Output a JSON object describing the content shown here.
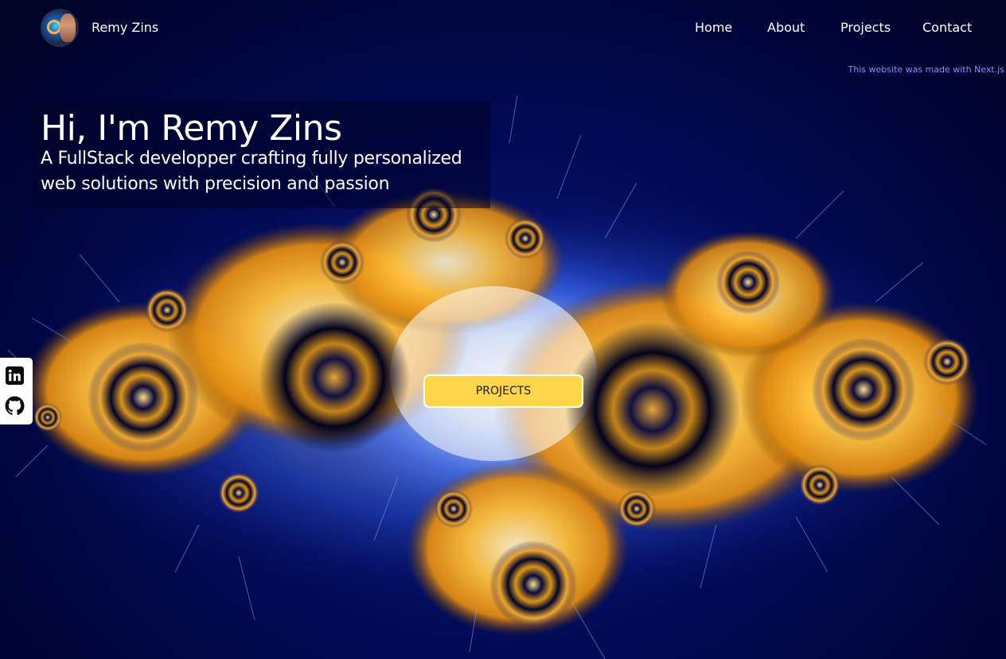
{
  "header": {
    "brand_name": "Remy Zins",
    "avatar_icon": "avatar-photo",
    "nav": [
      {
        "label": "Home"
      },
      {
        "label": "About"
      },
      {
        "label": "Projects"
      },
      {
        "label": "Contact"
      }
    ]
  },
  "notice": {
    "made_with": "This website was made with Next.js"
  },
  "hero": {
    "title": "Hi, I'm Remy Zins",
    "subtitle": "A FullStack developper crafting fully personalized web solutions with precision and passion",
    "cta_label": "PROJECTS"
  },
  "social": {
    "items": [
      {
        "icon": "linkedin-icon"
      },
      {
        "icon": "github-icon"
      }
    ]
  },
  "colors": {
    "background": "#00053a",
    "accent_button": "#ffd54a",
    "notice_text": "#8a8cff",
    "fractal_gold": "#f5a623",
    "fractal_blue": "#2a5aff"
  }
}
